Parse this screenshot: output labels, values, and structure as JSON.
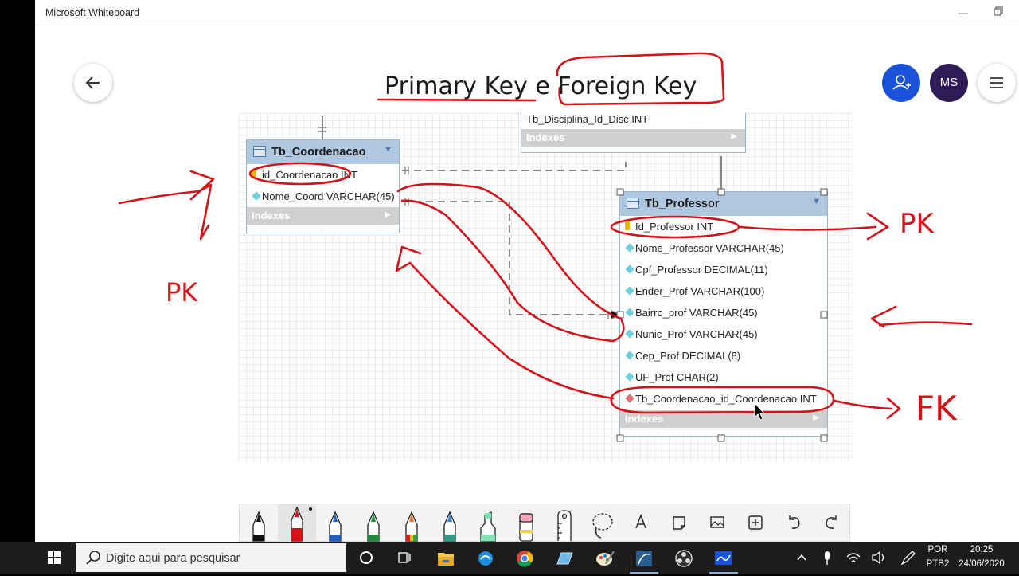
{
  "window": {
    "app_title": "Microsoft Whiteboard"
  },
  "header": {
    "user_initials": "MS"
  },
  "board": {
    "title": "Primary Key e Foreign Key",
    "annotations": {
      "pk_right": "PK",
      "pk_left": "PK",
      "fk": "FK"
    }
  },
  "diagram": {
    "partial_table": {
      "column": "Tb_Disciplina_Id_Disc INT",
      "indexes_label": "Indexes"
    },
    "coordenacao": {
      "name": "Tb_Coordenacao",
      "columns": [
        "id_Coordenacao INT",
        "Nome_Coord VARCHAR(45)"
      ],
      "indexes_label": "Indexes"
    },
    "professor": {
      "name": "Tb_Professor",
      "columns": [
        "Id_Professor INT",
        "Nome_Professor VARCHAR(45)",
        "Cpf_Professor DECIMAL(11)",
        "Ender_Prof VARCHAR(100)",
        "Bairro_prof VARCHAR(45)",
        "Nunic_Prof VARCHAR(45)",
        "Cep_Prof DECIMAL(8)",
        "UF_Prof CHAR(2)",
        "Tb_Coordenacao_id_Coordenacao INT"
      ],
      "indexes_label": "Indexes"
    }
  },
  "toolbar": {
    "tools": [
      "pen-black",
      "pen-red",
      "pen-blue",
      "pen-green",
      "pen-rainbow",
      "pen-galaxy",
      "highlighter",
      "eraser",
      "ruler",
      "lasso",
      "text",
      "note",
      "image",
      "add",
      "undo",
      "redo"
    ],
    "colors": {
      "red": "#e0201e",
      "blue": "#1f5fc6",
      "green": "#1f8a3a",
      "highlighter": "#7fe0b0",
      "eraser": "#f4a6b8"
    }
  },
  "taskbar": {
    "search_placeholder": "Digite aqui para pesquisar",
    "language": "POR",
    "keyboard": "PTB2",
    "time": "20:25",
    "date": "24/06/2020"
  },
  "colors": {
    "accent": "#1a53d9",
    "avatar": "#2f1c57",
    "ink": "#d4121a",
    "entity_header": "#afc8e0"
  }
}
